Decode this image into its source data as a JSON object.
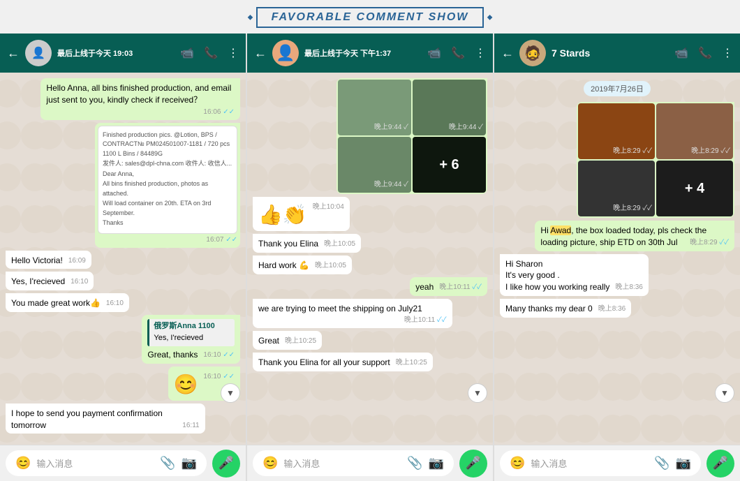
{
  "title": "FAVORABLE COMMENT SHOW",
  "panel1": {
    "header": {
      "name": "最后上线于今天 19:03",
      "avatar_emoji": "👤"
    },
    "messages": [
      {
        "type": "out",
        "text": "Hello Anna,  all bins finished production, and email just sent to you, kindly check if received？",
        "time": "16:06",
        "check": "✓✓"
      },
      {
        "type": "out_email",
        "time": "16:07",
        "check": "✓✓"
      },
      {
        "type": "in",
        "text": "Hello Victoria!",
        "time": "16:09"
      },
      {
        "type": "in",
        "text": "Yes, I'recieved",
        "time": "16:10"
      },
      {
        "type": "in",
        "text": "You made great work👍",
        "time": "16:10"
      },
      {
        "type": "reply_out",
        "reply_sender": "俄罗斯Anna 1100",
        "reply_text": "Yes, I'recieved",
        "text": "Great, thanks",
        "time": "16:10",
        "check": "✓✓"
      },
      {
        "type": "out_emoji",
        "emoji": "😊",
        "time": "16:10",
        "check": "✓✓"
      },
      {
        "type": "in_partial",
        "text": "I hope to send you payment confirmation tomorrow",
        "time": "16:11"
      }
    ],
    "footer": {
      "placeholder": "输入消息"
    }
  },
  "panel2": {
    "header": {
      "name": "最后上线于今天 下午1:37",
      "avatar_emoji": "👤"
    },
    "messages": [
      {
        "type": "img_grid_out",
        "count": "+6",
        "time": "晚上9:44"
      },
      {
        "type": "in_emoji",
        "text": "👍👏",
        "time": "晚上10:04"
      },
      {
        "type": "in",
        "text": "Thank you Elina",
        "time": "晚上10:05"
      },
      {
        "type": "in",
        "text": "Hard work 💪",
        "time": "晚上10:05"
      },
      {
        "type": "out",
        "text": "yeah",
        "time": "晚上10:11",
        "check": "✓✓"
      },
      {
        "type": "in",
        "text": "we are trying to meet the shipping on July21",
        "time": "晚上10:11",
        "check": "✓✓"
      },
      {
        "type": "in",
        "text": "Great",
        "time": "晚上10:25"
      },
      {
        "type": "in",
        "text": "Thank you Elina for all your support",
        "time": "晚上10:25"
      }
    ],
    "footer": {
      "placeholder": "输入消息"
    }
  },
  "panel3": {
    "header": {
      "name": "7 Stards",
      "avatar_emoji": "🧔"
    },
    "messages": [
      {
        "type": "date",
        "text": "2019年7月26日"
      },
      {
        "type": "cargo_grid",
        "plus": "+4",
        "time": "晚上8:29",
        "check": "✓✓"
      },
      {
        "type": "out",
        "text_html": "Hi <mark>Awad</mark>, the box loaded today, pls check the loading picture, ship ETD on 30th Jul",
        "time": "晚上8:29",
        "check": "✓✓"
      },
      {
        "type": "in",
        "text": "Hi Sharon\nIt's very good .\nI like how you working really",
        "time": "晚上8:36"
      },
      {
        "type": "in",
        "text": "Many thanks my dear 0",
        "time": "晚上8:36"
      }
    ],
    "footer": {
      "placeholder": "输入消息"
    }
  }
}
